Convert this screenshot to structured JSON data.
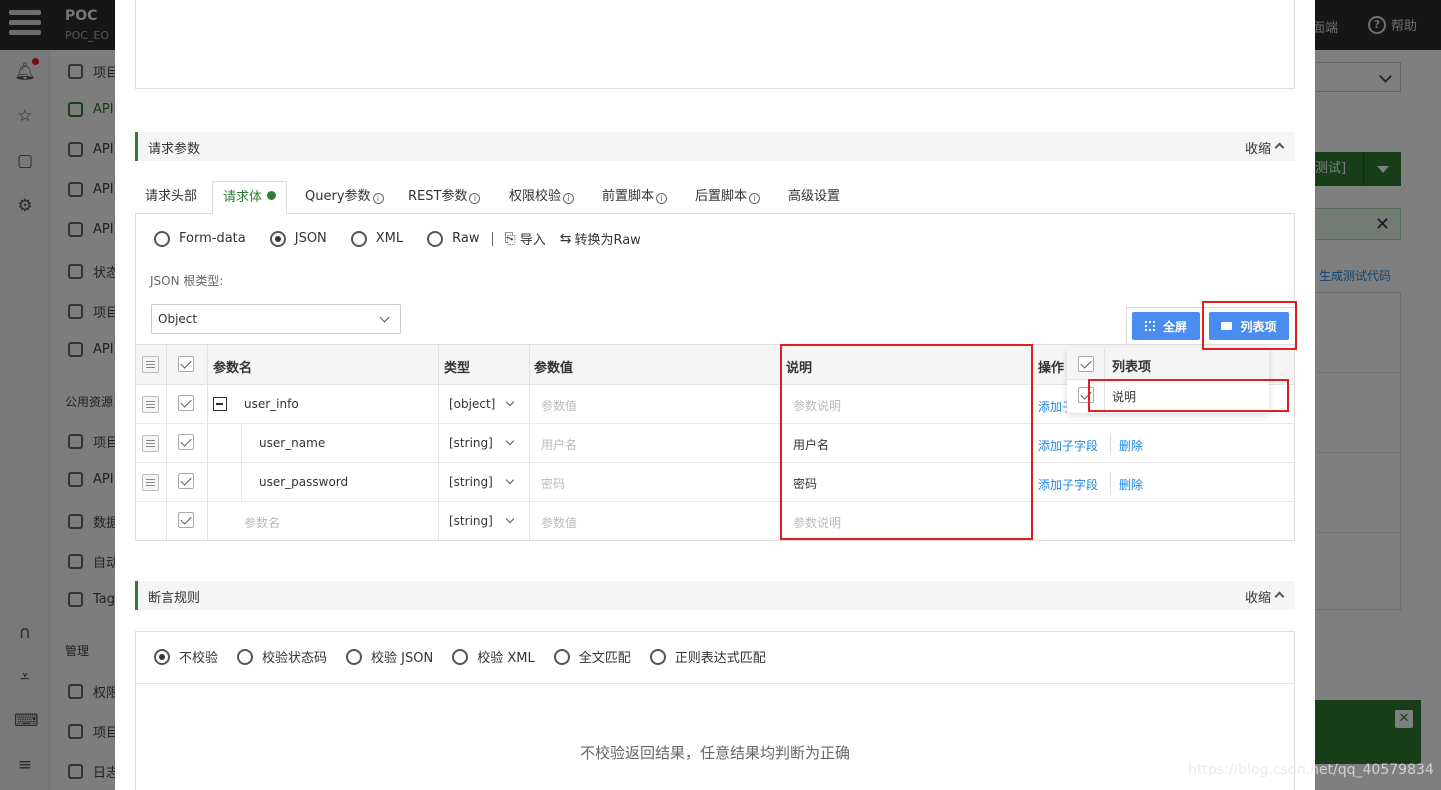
{
  "app": {
    "project_name": "POC",
    "project_sub": "POC_EO",
    "top_right_item": "面端",
    "help_label": "帮助",
    "help_icon": "question-circle-icon",
    "nav_head_public": "公用资源",
    "nav_head_manage": "管理",
    "nav_items": [
      {
        "label": "项目",
        "icon": "list-icon"
      },
      {
        "label": "API",
        "icon": "tag-icon",
        "active": true
      },
      {
        "label": "API",
        "icon": "bolt-icon"
      },
      {
        "label": "API",
        "icon": "clipboard-icon"
      },
      {
        "label": "API",
        "icon": "calendar-icon"
      },
      {
        "label": "状态",
        "icon": "doc-icon"
      },
      {
        "label": "项目",
        "icon": "list-icon"
      },
      {
        "label": "API",
        "icon": "copy-icon"
      }
    ],
    "nav_items_public": [
      {
        "label": "项目",
        "icon": "cube-icon"
      },
      {
        "label": "API",
        "icon": "cube-icon"
      },
      {
        "label": "数据",
        "icon": "cube-icon"
      },
      {
        "label": "自动",
        "icon": "cube-icon"
      },
      {
        "label": "Tag",
        "icon": "cube-icon"
      }
    ],
    "nav_items_manage": [
      {
        "label": "权限",
        "icon": "user-icon"
      },
      {
        "label": "项目",
        "icon": "gear-icon"
      },
      {
        "label": "日志",
        "icon": "clipboard-icon"
      }
    ],
    "right_button_label": "测试]",
    "right_link": "生成测试代码",
    "accent_color": "#2e7d32",
    "link_color": "#1e88e5",
    "button_blue": "#4a8cf0",
    "highlight_red": "#e02020"
  },
  "request_params": {
    "title": "请求参数",
    "collapse_label": "收缩",
    "tabs": [
      {
        "label": "请求头部"
      },
      {
        "label": "请求体",
        "active": true
      },
      {
        "label": "Query参数",
        "info": true
      },
      {
        "label": "REST参数",
        "info": true
      },
      {
        "label": "权限校验",
        "info": true
      },
      {
        "label": "前置脚本",
        "info": true
      },
      {
        "label": "后置脚本",
        "info": true
      },
      {
        "label": "高级设置"
      }
    ],
    "body_types": [
      {
        "label": "Form-data",
        "selected": false
      },
      {
        "label": "JSON",
        "selected": true
      },
      {
        "label": "XML",
        "selected": false
      },
      {
        "label": "Raw",
        "selected": false
      }
    ],
    "import_label": "导入",
    "convert_label": "转换为Raw",
    "json_root_label": "JSON 根类型:",
    "json_root_value": "Object",
    "fullscreen_label": "全屏",
    "columns_label": "列表项",
    "table": {
      "headers": {
        "name": "参数名",
        "type": "类型",
        "value": "参数值",
        "desc": "说明",
        "ops": "操作"
      },
      "rows": [
        {
          "name": "user_info",
          "type": "[object]",
          "value_ph": "参数值",
          "value": "",
          "desc_ph": "参数说明",
          "desc": "",
          "ops": [
            "添加子字段"
          ],
          "root": true
        },
        {
          "name": "user_name",
          "type": "[string]",
          "value_ph": "用户名",
          "value": "",
          "desc_ph": "",
          "desc": "用户名",
          "ops": [
            "添加子字段",
            "删除"
          ]
        },
        {
          "name": "user_password",
          "type": "[string]",
          "value_ph": "密码",
          "value": "",
          "desc_ph": "",
          "desc": "密码",
          "ops": [
            "添加子字段",
            "删除"
          ]
        },
        {
          "name_ph": "参数名",
          "type": "[string]",
          "value_ph": "参数值",
          "desc_ph": "参数说明",
          "ops": []
        }
      ]
    },
    "column_popup": {
      "header": "列表项",
      "items": [
        {
          "label": "说明",
          "checked": true
        }
      ]
    }
  },
  "assertion": {
    "title": "断言规则",
    "collapse_label": "收缩",
    "options": [
      {
        "label": "不校验",
        "selected": true
      },
      {
        "label": "校验状态码",
        "selected": false
      },
      {
        "label": "校验 JSON",
        "selected": false
      },
      {
        "label": "校验 XML",
        "selected": false
      },
      {
        "label": "全文匹配",
        "selected": false
      },
      {
        "label": "正则表达式匹配",
        "selected": false
      }
    ],
    "message": "不校验返回结果，任意结果均判断为正确"
  },
  "watermark": "https://blog.csdn.net/qq_40579834"
}
